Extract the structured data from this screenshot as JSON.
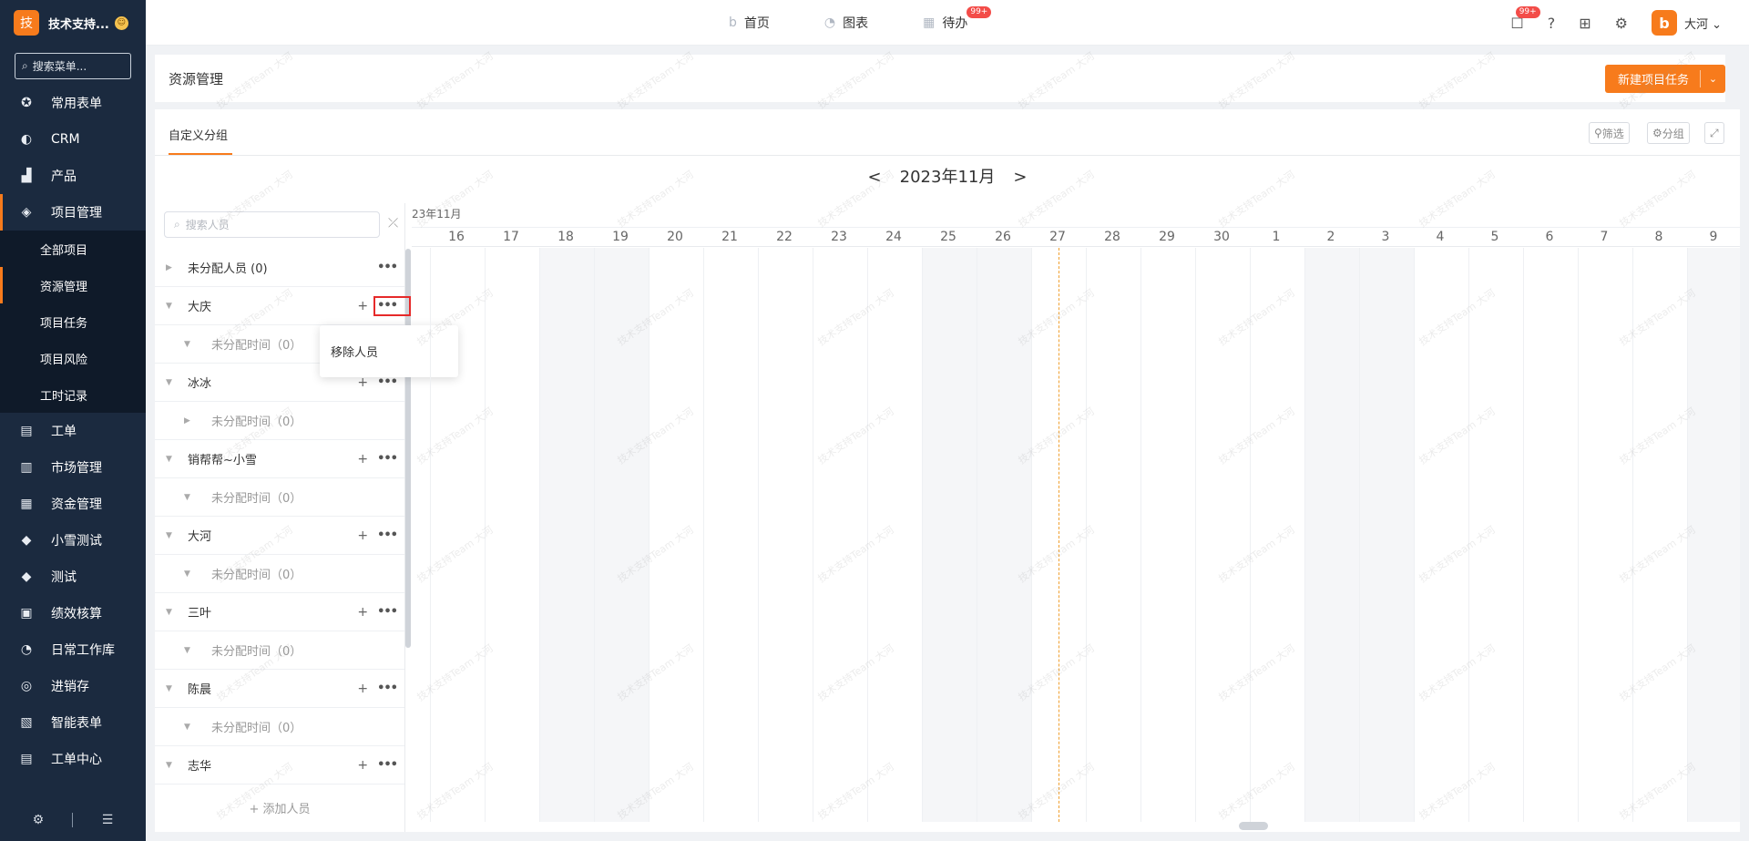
{
  "app": {
    "logo_char": "技",
    "name": "技术支持...",
    "badge": "☺",
    "search_placeholder": "搜索菜单..."
  },
  "sidebar": {
    "items": [
      {
        "label": "常用表单",
        "icon": "star-icon",
        "glyph": "✪"
      },
      {
        "label": "CRM",
        "icon": "crm-icon",
        "glyph": "◐"
      },
      {
        "label": "产品",
        "icon": "product-icon",
        "glyph": "▟"
      },
      {
        "label": "项目管理",
        "icon": "layers-icon",
        "glyph": "◈"
      }
    ],
    "sub_items": [
      "全部项目",
      "资源管理",
      "项目任务",
      "项目风险",
      "工时记录"
    ],
    "items_after": [
      {
        "label": "工单",
        "icon": "clipboard-icon",
        "glyph": "▤"
      },
      {
        "label": "市场管理",
        "icon": "market-icon",
        "glyph": "▥"
      },
      {
        "label": "资金管理",
        "icon": "fund-icon",
        "glyph": "▦"
      },
      {
        "label": "小雪测试",
        "icon": "tag-icon",
        "glyph": "◆"
      },
      {
        "label": "测试",
        "icon": "tag-icon",
        "glyph": "◆"
      },
      {
        "label": "绩效核算",
        "icon": "doc-icon",
        "glyph": "▣"
      },
      {
        "label": "日常工作库",
        "icon": "chart-icon",
        "glyph": "◔"
      },
      {
        "label": "进销存",
        "icon": "cycle-icon",
        "glyph": "◎"
      },
      {
        "label": "智能表单",
        "icon": "form-icon",
        "glyph": "▧"
      },
      {
        "label": "工单中心",
        "icon": "clipboard-icon",
        "glyph": "▤"
      }
    ]
  },
  "topbar": {
    "home": "首页",
    "charts": "图表",
    "todo": "待办",
    "todo_badge": "99+",
    "msg_badge": "99+",
    "avatar_char": "b",
    "user": "大河"
  },
  "page": {
    "title": "资源管理",
    "new_button": "新建项目任务",
    "tab": "自定义分组",
    "filter_btn": "筛选",
    "group_btn": "分组",
    "month": "2023年11月",
    "search_person": "搜索人员",
    "add_person": "+ 添加人员",
    "popup_remove": "移除人员"
  },
  "people": [
    {
      "name": "未分配人员 (0)",
      "sub": null
    },
    {
      "name": "大庆",
      "sub": "未分配时间（0）"
    },
    {
      "name": "冰冰",
      "sub": "未分配时间（0）"
    },
    {
      "name": "销帮帮~小雪",
      "sub": "未分配时间（0）"
    },
    {
      "name": "大河",
      "sub": "未分配时间（0）"
    },
    {
      "name": "三叶",
      "sub": "未分配时间（0）"
    },
    {
      "name": "陈晨",
      "sub": "未分配时间（0）"
    },
    {
      "name": "志华",
      "sub": null
    }
  ],
  "gantt": {
    "month_label": "23年11月",
    "days": [
      "16",
      "17",
      "18",
      "19",
      "20",
      "21",
      "22",
      "23",
      "24",
      "25",
      "26",
      "27",
      "28",
      "29",
      "30",
      "1",
      "2",
      "3",
      "4",
      "5",
      "6",
      "7",
      "8",
      "9"
    ],
    "weekend_days": [
      "18",
      "19",
      "25",
      "26",
      "2",
      "3",
      "9"
    ],
    "today": "27"
  },
  "watermark": {
    "line1": "技术支持Team",
    "line2": "大河"
  }
}
